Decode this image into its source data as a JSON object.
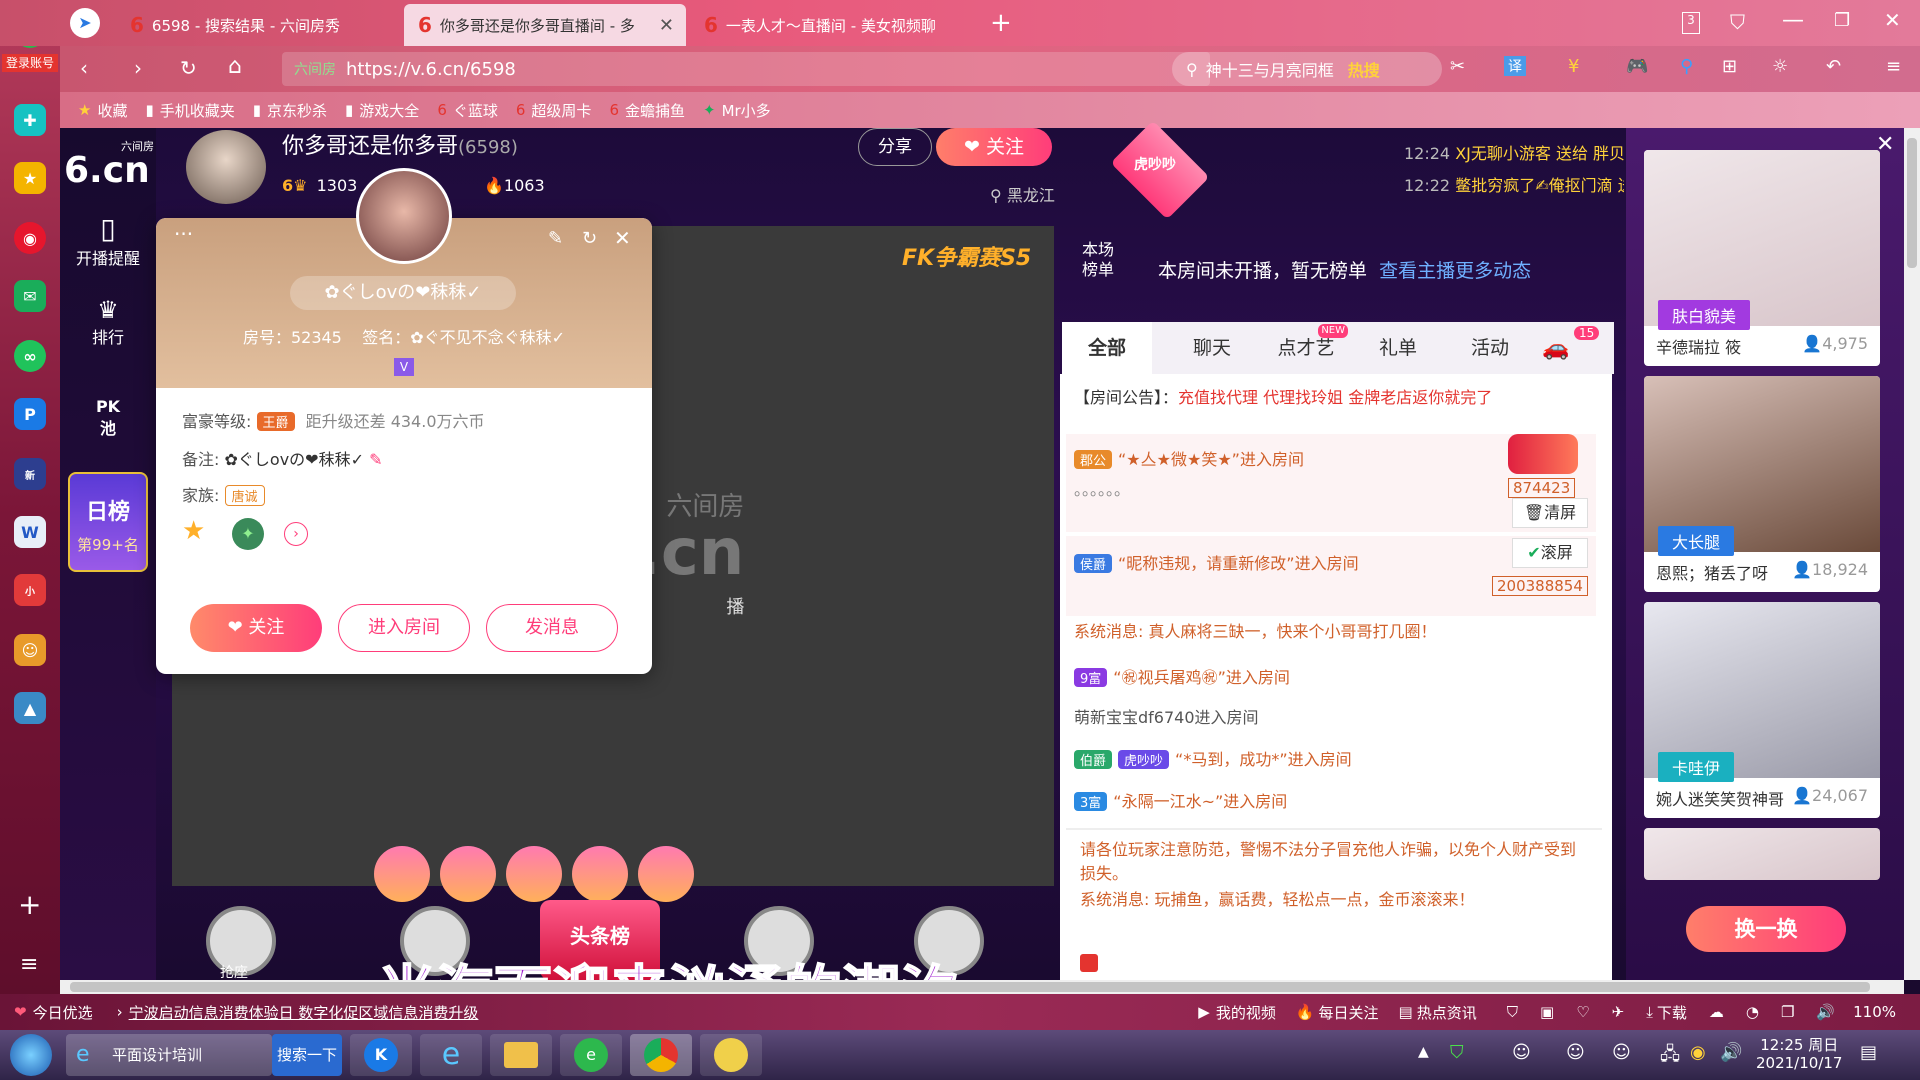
{
  "tabs": [
    {
      "label": "6598 - 搜索结果 - 六间房秀"
    },
    {
      "label": "你多哥还是你多哥直播间 - 多"
    },
    {
      "label": "一表人才～直播间 - 美女视频聊"
    }
  ],
  "tab_counter": "3",
  "address": {
    "url_prefix": "六间房",
    "url": "https://v.6.cn/6598"
  },
  "search": {
    "placeholder": "神十三与月亮同框",
    "hot": "热搜"
  },
  "bookmarks": [
    "收藏",
    "手机收藏夹",
    "京东秒杀",
    "游戏大全",
    "ぐ蓝球",
    "超级周卡",
    "金蟾捕鱼",
    "Mr小多"
  ],
  "dock": {
    "login": "登录账号"
  },
  "leftnav": {
    "logo_small": "六间房",
    "logo": "6.cn",
    "items": [
      "开播提醒",
      "排行",
      "PK池"
    ],
    "rank_title": "日榜",
    "rank_value": "第99+名"
  },
  "anchor": {
    "name": "你多哥还是你多哥",
    "room_id": "(6598)",
    "level": "6",
    "fans": "1303",
    "heat": "1063",
    "share": "分享",
    "follow": "关注",
    "location": "黑龙江"
  },
  "top_feed": [
    {
      "time": "12:24",
      "text": "XJ无聊小游客 送给 胖贝森无西无瑕"
    },
    {
      "time": "12:22",
      "text": "鳖批穷疯了✍俺抠门滴 送"
    }
  ],
  "rank_banner": {
    "tag": "虎吵吵",
    "label1": "本场",
    "label2": "榜单",
    "text": "本房间未开播，暂无榜单",
    "link": "查看主播更多动态"
  },
  "video": {
    "promo": "FK争霸赛S5",
    "logo_small": "六间房",
    "logo": "6.cn",
    "offline": "播",
    "subtitle": "当海面迎来汹涌的潮汐",
    "headline": "头条榜"
  },
  "chat_tabs": [
    {
      "label": "全部"
    },
    {
      "label": "聊天"
    },
    {
      "label": "点才艺",
      "badge": "NEW"
    },
    {
      "label": "礼单"
    },
    {
      "label": "活动"
    }
  ],
  "car_count": "15",
  "notice": {
    "label": "【房间公告】：",
    "text": "充值找代理 代理找玲姐 金牌老店返你就完了"
  },
  "chat": [
    {
      "badge": "郡公",
      "text": "“★亼★微★笑★”进入房间"
    },
    {
      "text": "。。。。。。"
    },
    {
      "badge": "侯爵",
      "text": "“昵称违规，请重新修改”进入房间"
    },
    {
      "text": "系统消息: 真人麻将三缺一，快来个小哥哥打几圈！"
    },
    {
      "badge": "9富",
      "text": "“㊗视兵屠鸡㊗”进入房间"
    },
    {
      "text": "萌新宝宝df6740进入房间"
    },
    {
      "badge": "伯爵",
      "badge2": "虎吵吵",
      "text": "“*马到，成功*”进入房间"
    },
    {
      "badge": "3富",
      "text": "“永隔一江水~”进入房间"
    }
  ],
  "gift_values": [
    "874423",
    "200388854"
  ],
  "chat_tools": [
    "清屏",
    "滚屏"
  ],
  "warning": "请各位玩家注意防范，警惕不法分子冒充他人诈骗，以免个人财产受到损失。",
  "sys_msg2": "系统消息: 玩捕鱼，赢话费，轻松点一点，金币滚滚来！",
  "sidebar_cards": [
    {
      "badge": "肤白貌美",
      "name": "辛德瑞拉 筱",
      "count": "4,975"
    },
    {
      "badge": "大长腿",
      "name": "恩熙；猪丢了呀",
      "count": "18,924"
    },
    {
      "badge": "卡哇伊",
      "name": "婉人迷笑笑贺神哥",
      "count": "24,067"
    }
  ],
  "switch_btn": "换一换",
  "popup": {
    "name": "✿ぐしovの❤秣秣✓",
    "room": "房号：52345",
    "sign": "签名：✿ぐ不见不念ぐ秣秣✓",
    "level_label": "富豪等级:",
    "level": "王爵",
    "upgrade": "距升级还差 434.0万六币",
    "note_label": "备注:",
    "note": "✿ぐしovの❤秣秣✓",
    "family_label": "家族:",
    "family": "唐诚",
    "btn_follow": "关注",
    "btn_enter": "进入房间",
    "btn_msg": "发消息"
  },
  "seat": "抢座",
  "statusbar": {
    "left": "今日优选",
    "news": "宁波启动信息消费体验日 数字化促区域信息消费升级",
    "items": [
      "我的视频",
      "每日关注",
      "热点资讯",
      "下载"
    ],
    "zoom": "110%"
  },
  "taskbar": {
    "app1": "平面设计培训",
    "search_btn": "搜索一下",
    "time": "12:25 周日",
    "date": "2021/10/17"
  }
}
